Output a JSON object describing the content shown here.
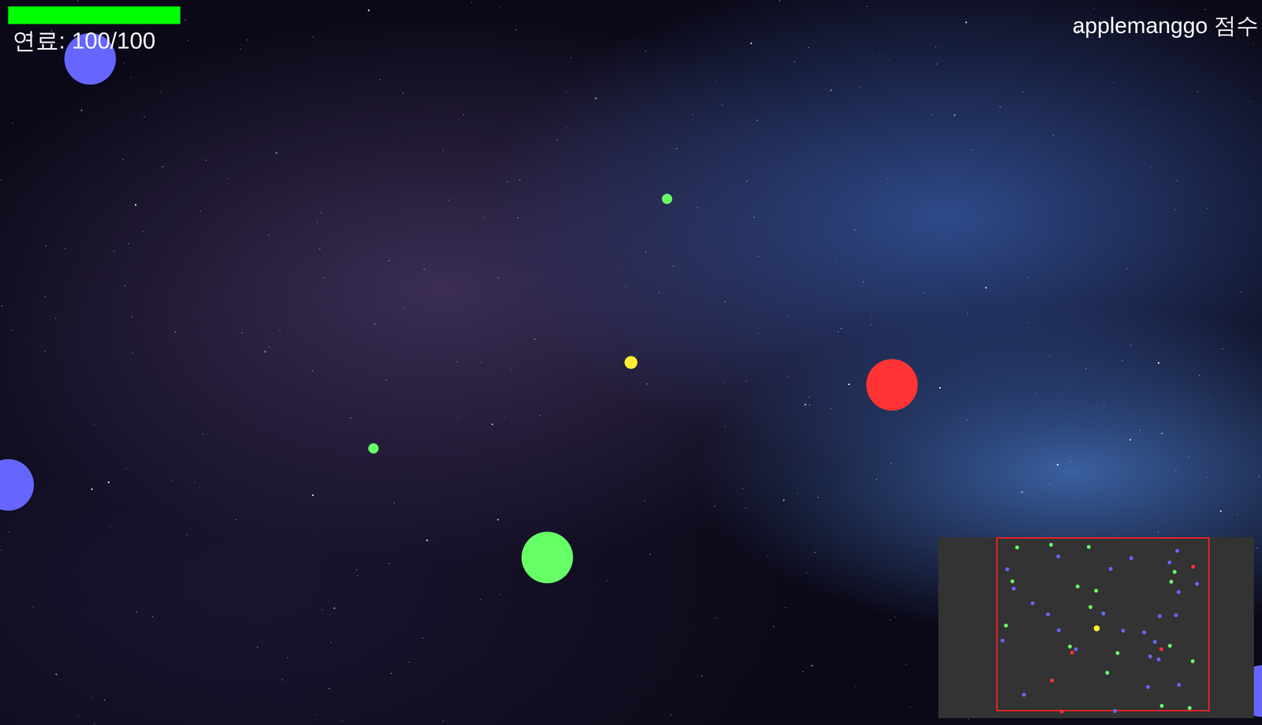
{
  "hud": {
    "fuel_label": "연료: 100/100",
    "fuel_level": 1.0,
    "fuel_color": "#00ff00",
    "score_label": "applemanggo 점수"
  },
  "cells": [
    {
      "kind": "food",
      "color": "#6666ff"
    },
    {
      "kind": "food",
      "color": "#6666ff"
    },
    {
      "kind": "food",
      "color": "#66ff66"
    },
    {
      "kind": "player",
      "color": "#ffee33"
    },
    {
      "kind": "food",
      "color": "#66ff66"
    },
    {
      "kind": "food",
      "color": "#ff3333"
    },
    {
      "kind": "food",
      "color": "#66ff66"
    },
    {
      "kind": "food",
      "color": "#6666ff"
    }
  ],
  "minimap": {
    "player_color": "#ffee33",
    "border_color": "#ff2222",
    "dot_colors": [
      "#6666ff",
      "#66ff66",
      "#6666ff",
      "#6666ff",
      "#66ff66",
      "#ff3333",
      "#6666ff",
      "#66ff66",
      "#6666ff",
      "#6666ff",
      "#66ff66",
      "#6666ff",
      "#66ff66",
      "#6666ff",
      "#ff3333",
      "#6666ff",
      "#66ff66",
      "#6666ff",
      "#6666ff",
      "#66ff66",
      "#6666ff",
      "#66ff66",
      "#6666ff",
      "#ff3333",
      "#6666ff",
      "#66ff66",
      "#6666ff",
      "#6666ff",
      "#66ff66",
      "#6666ff",
      "#66ff66",
      "#6666ff",
      "#6666ff",
      "#66ff66",
      "#ff3333",
      "#6666ff",
      "#66ff66",
      "#6666ff",
      "#6666ff",
      "#66ff66",
      "#6666ff",
      "#66ff66",
      "#6666ff",
      "#66ff66",
      "#6666ff",
      "#ff3333",
      "#6666ff",
      "#66ff66"
    ]
  }
}
